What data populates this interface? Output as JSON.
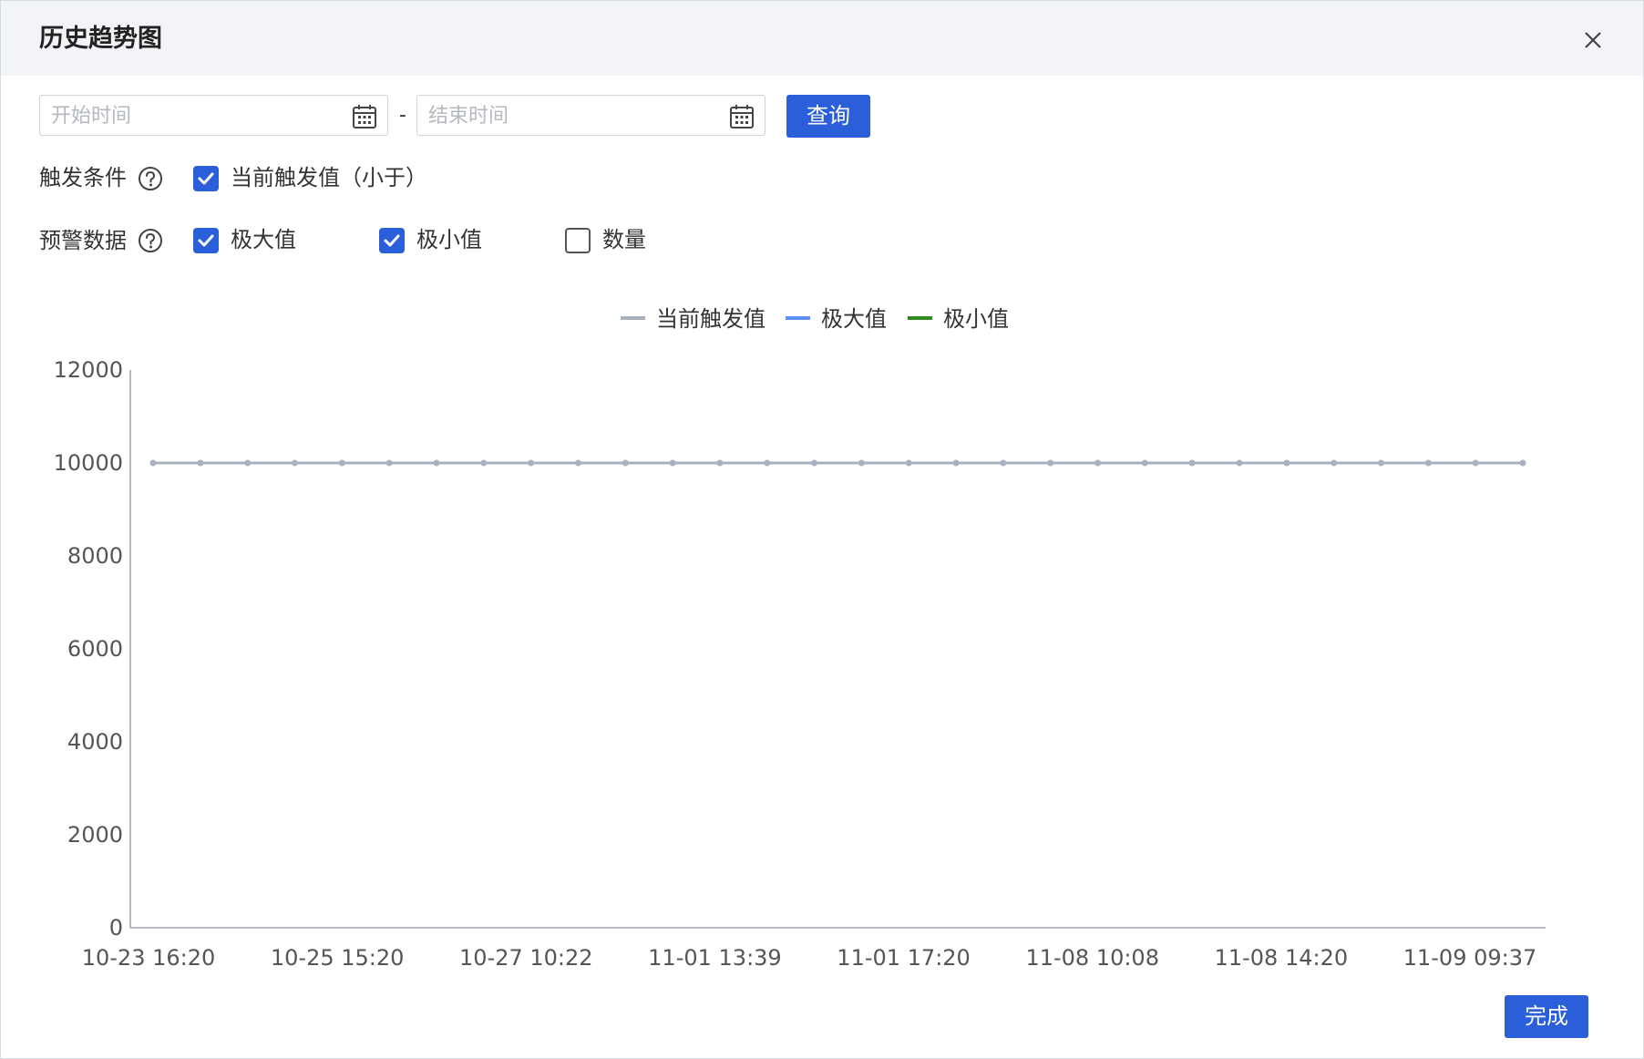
{
  "dialog": {
    "title": "历史趋势图"
  },
  "filters": {
    "start_placeholder": "开始时间",
    "end_placeholder": "结束时间",
    "separator": "-",
    "query_label": "查询"
  },
  "trigger": {
    "label": "触发条件",
    "options": [
      {
        "label": "当前触发值（小于）",
        "checked": true
      }
    ]
  },
  "warning": {
    "label": "预警数据",
    "options": [
      {
        "label": "极大值",
        "checked": true
      },
      {
        "label": "极小值",
        "checked": true
      },
      {
        "label": "数量",
        "checked": false
      }
    ]
  },
  "footer": {
    "done_label": "完成"
  },
  "chart_data": {
    "type": "line",
    "title": "",
    "xlabel": "",
    "ylabel": "",
    "ylim": [
      0,
      12000
    ],
    "yticks": [
      0,
      2000,
      4000,
      6000,
      8000,
      10000,
      12000
    ],
    "xtick_labels": [
      "10-23 16:20",
      "10-25 15:20",
      "10-27 10:22",
      "11-01 13:39",
      "11-01 17:20",
      "11-08 10:08",
      "11-08 14:20",
      "11-09 09:37"
    ],
    "point_count": 30,
    "legend_position": "top-center",
    "grid": false,
    "series": [
      {
        "name": "当前触发值",
        "color": "#a9b1be",
        "values": [
          10000,
          10000,
          10000,
          10000,
          10000,
          10000,
          10000,
          10000,
          10000,
          10000,
          10000,
          10000,
          10000,
          10000,
          10000,
          10000,
          10000,
          10000,
          10000,
          10000,
          10000,
          10000,
          10000,
          10000,
          10000,
          10000,
          10000,
          10000,
          10000,
          10000
        ]
      },
      {
        "name": "极大值",
        "color": "#5b8ff9",
        "values": []
      },
      {
        "name": "极小值",
        "color": "#2e8b1e",
        "values": []
      }
    ]
  }
}
